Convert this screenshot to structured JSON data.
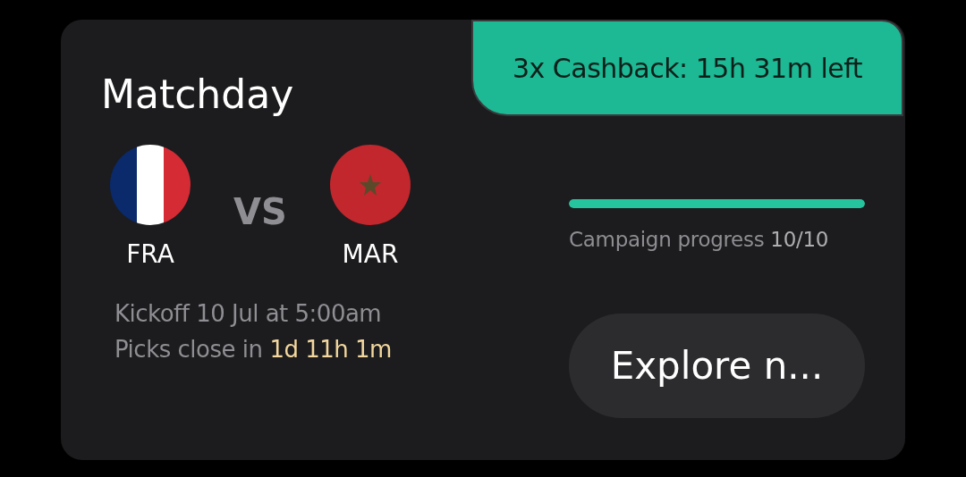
{
  "card": {
    "title": "Matchday",
    "badge": "3x Cashback: 15h 31m left"
  },
  "teams": [
    {
      "code": "FRA",
      "kind": "tricolor"
    },
    {
      "code": "MAR",
      "kind": "star"
    }
  ],
  "versus": "VS",
  "kickoff": "Kickoff 10 Jul at 5:00am",
  "picks": {
    "label": "Picks close in",
    "countdown": "1d 11h 1m"
  },
  "progress": {
    "level": 1,
    "label": "Campaign progress",
    "reading": "10/10"
  },
  "button": "Explore n..."
}
